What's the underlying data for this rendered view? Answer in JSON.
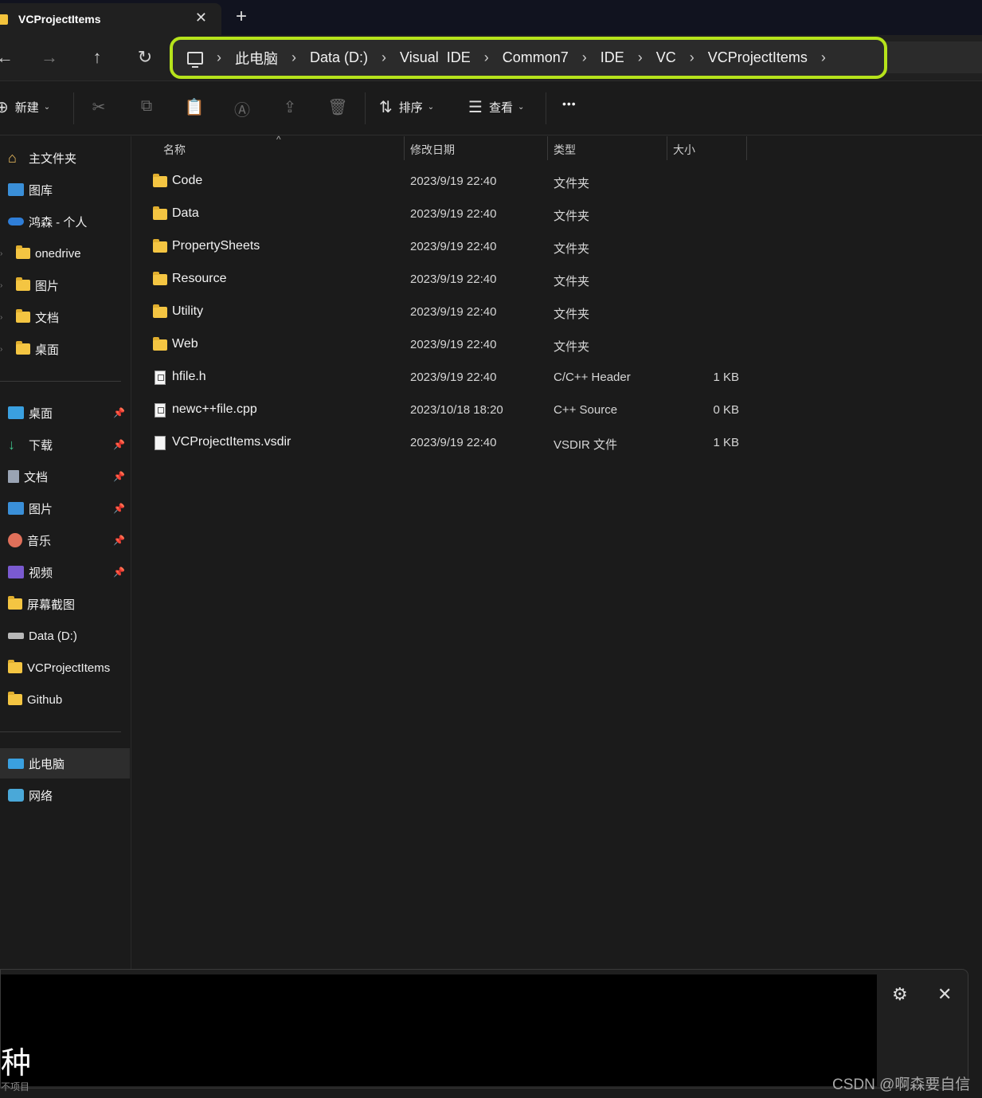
{
  "tab": {
    "title": "VCProjectItems",
    "close": "✕",
    "new_tab": "+"
  },
  "nav": {
    "back": "←",
    "forward": "→",
    "up": "↑",
    "refresh": "↻"
  },
  "breadcrumb": [
    "此电脑",
    "Data (D:)",
    "Visual  IDE",
    "Common7",
    "IDE",
    "VC",
    "VCProjectItems"
  ],
  "breadcrumb_sep": "›",
  "toolbar": {
    "new_label": "新建",
    "sort_label": "排序",
    "view_label": "查看",
    "more": "•••"
  },
  "sidebar": {
    "top": [
      {
        "label": "主文件夹",
        "icon": "home-icon"
      },
      {
        "label": "图库",
        "icon": "gallery-icon"
      },
      {
        "label": "鸿森 - 个人",
        "icon": "onedrive-icon"
      },
      {
        "label": "onedrive",
        "icon": "folder-icon"
      },
      {
        "label": "图片",
        "icon": "folder-icon"
      },
      {
        "label": "文档",
        "icon": "folder-icon"
      },
      {
        "label": "桌面",
        "icon": "folder-icon"
      }
    ],
    "quick": [
      {
        "label": "桌面",
        "icon": "desktop-icon",
        "pinned": true
      },
      {
        "label": "下载",
        "icon": "download-icon",
        "pinned": true
      },
      {
        "label": "文档",
        "icon": "document-icon",
        "pinned": true
      },
      {
        "label": "图片",
        "icon": "pictures-icon",
        "pinned": true
      },
      {
        "label": "音乐",
        "icon": "music-icon",
        "pinned": true
      },
      {
        "label": "视频",
        "icon": "video-icon",
        "pinned": true
      },
      {
        "label": "屏幕截图",
        "icon": "folder-icon",
        "pinned": false
      },
      {
        "label": "Data (D:)",
        "icon": "drive-icon",
        "pinned": false
      },
      {
        "label": "VCProjectItems",
        "icon": "folder-icon",
        "pinned": false
      },
      {
        "label": "Github",
        "icon": "folder-icon",
        "pinned": false
      }
    ],
    "bottom": [
      {
        "label": "此电脑",
        "icon": "computer-icon",
        "selected": true
      },
      {
        "label": "网络",
        "icon": "network-icon",
        "selected": false
      }
    ]
  },
  "columns": {
    "name": "名称",
    "date": "修改日期",
    "type": "类型",
    "size": "大小"
  },
  "files": [
    {
      "name": "Code",
      "date": "2023/9/19 22:40",
      "type": "文件夹",
      "size": "",
      "kind": "folder"
    },
    {
      "name": "Data",
      "date": "2023/9/19 22:40",
      "type": "文件夹",
      "size": "",
      "kind": "folder"
    },
    {
      "name": "PropertySheets",
      "date": "2023/9/19 22:40",
      "type": "文件夹",
      "size": "",
      "kind": "folder"
    },
    {
      "name": "Resource",
      "date": "2023/9/19 22:40",
      "type": "文件夹",
      "size": "",
      "kind": "folder"
    },
    {
      "name": "Utility",
      "date": "2023/9/19 22:40",
      "type": "文件夹",
      "size": "",
      "kind": "folder"
    },
    {
      "name": "Web",
      "date": "2023/9/19 22:40",
      "type": "文件夹",
      "size": "",
      "kind": "folder"
    },
    {
      "name": "hfile.h",
      "date": "2023/9/19 22:40",
      "type": "C/C++ Header",
      "size": "1 KB",
      "kind": "code"
    },
    {
      "name": "newc++file.cpp",
      "date": "2023/10/18 18:20",
      "type": "C++ Source",
      "size": "0 KB",
      "kind": "code"
    },
    {
      "name": "VCProjectItems.vsdir",
      "date": "2023/9/19 22:40",
      "type": "VSDIR 文件",
      "size": "1 KB",
      "kind": "doc"
    }
  ],
  "overlay": {
    "char": "种",
    "subtext": "不项目"
  },
  "watermark": "CSDN @啊森要自信",
  "colors": {
    "accent_highlight": "#b6e31b",
    "folder": "#f4c542",
    "bg": "#1b1b1b"
  }
}
